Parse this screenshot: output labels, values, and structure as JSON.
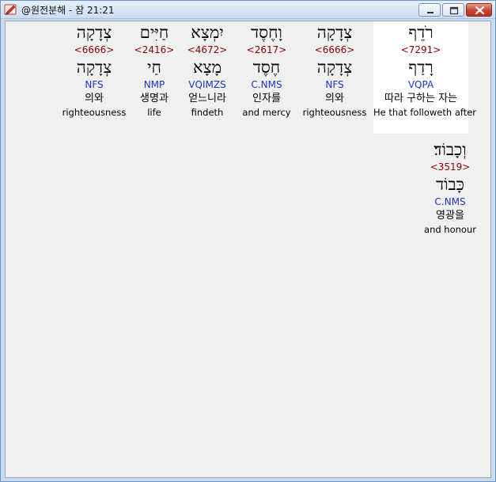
{
  "window": {
    "title": "@원전분해 - 잠 21:21"
  },
  "words": [
    {
      "hebrew": "רֹדֵף",
      "strong": "<7291>",
      "lemma": "רָדַף",
      "parse": "VQPA",
      "korean": "따라 구하는 자는",
      "english": "He that followeth after",
      "selected": true
    },
    {
      "hebrew": "צְדָקָה",
      "strong": "<6666>",
      "lemma": "צְדָקָה",
      "parse": "NFS",
      "korean": "의와",
      "english": "righteousness",
      "selected": false
    },
    {
      "hebrew": "וָחֶסֶד",
      "strong": "<2617>",
      "lemma": "חֶסֶד",
      "parse": "C.NMS",
      "korean": "인자를",
      "english": "and mercy",
      "selected": false
    },
    {
      "hebrew": "יִמְצָא",
      "strong": "<4672>",
      "lemma": "מָצָא",
      "parse": "VQIMZS",
      "korean": "얻느니라",
      "english": "findeth",
      "selected": false
    },
    {
      "hebrew": "חַיִּים",
      "strong": "<2416>",
      "lemma": "חַי",
      "parse": "NMP",
      "korean": "생명과",
      "english": "life",
      "selected": false
    },
    {
      "hebrew": "צְדָקָה",
      "strong": "<6666>",
      "lemma": "צְדָקָה",
      "parse": "NFS",
      "korean": "의와",
      "english": "righteousness",
      "selected": false
    },
    {
      "hebrew": "וְכָבוֹד׃",
      "strong": "<3519>",
      "lemma": "כָּבוֹד",
      "parse": "C.NMS",
      "korean": "영광을",
      "english": "and honour",
      "selected": false
    }
  ]
}
